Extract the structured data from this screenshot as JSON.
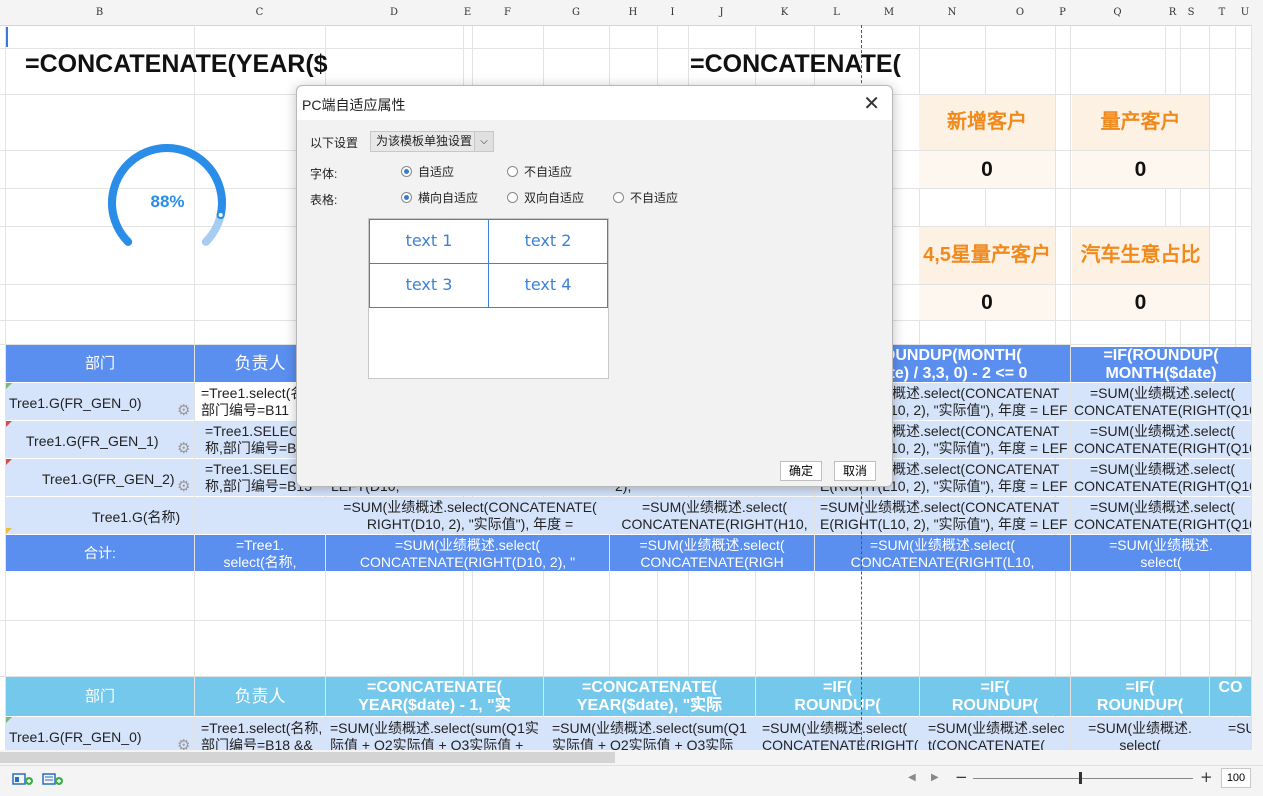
{
  "columns": [
    "B",
    "C",
    "D",
    "E",
    "F",
    "G",
    "H",
    "I",
    "J",
    "K",
    "L",
    "M",
    "N",
    "O",
    "P",
    "Q",
    "R",
    "S",
    "T",
    "U"
  ],
  "formulas": {
    "left": "=CONCATENATE(YEAR($",
    "right": "=CONCATENATE("
  },
  "gauge": {
    "value_text": "88%",
    "fraction": 0.88,
    "color": "#2a8ee8"
  },
  "kpis": [
    {
      "title": "新增客户",
      "value": "0"
    },
    {
      "title": "量产客户",
      "value": "0"
    },
    {
      "title": "4,5星量产客户",
      "value": "0"
    },
    {
      "title": "汽车生意占比",
      "value": "0"
    }
  ],
  "table1": {
    "headers": [
      "部门",
      "负责人",
      "=ROUNDUP(MONTH(\n$date) / 3,3, 0) - 2 <= 0",
      "=IF(ROUNDUP(\nMONTH($date)"
    ],
    "rows": [
      [
        "Tree1.G(FR_GEN_0)",
        "=Tree1.select(名\n部门编号=B11",
        "=SUM(业绩概述.select(CONCATENAT\nE(RIGHT(L10, 2), \"实际值\"), 年度 = LEF",
        "=SUM(业绩概述.select(\nCONCATENATE(RIGHT(Q10"
      ],
      [
        "Tree1.G(FR_GEN_1)",
        "=Tree1.SELECT\n称,部门编号=B",
        "=SUM(业绩概述.select(CONCATENAT\nE(RIGHT(L10, 2), \"实际值\"), 年度 = LEF",
        "=SUM(业绩概述.select(\nCONCATENATE(RIGHT(Q10"
      ],
      [
        "Tree1.G(FR_GEN_2)",
        "=Tree1.SELECT\n称,部门编号=B13",
        "=SUM(业绩概述.select(CONCATENAT\nE(RIGHT(L10, 2), \"实际值\"), 年度 = LEF",
        "=SUM(业绩概述.select(\nCONCATENATE(RIGHT(Q10"
      ],
      [
        "Tree1.G(名称)",
        "",
        "=SUM(业绩概述.select(CONCATENAT\nE(RIGHT(L10, 2), \"实际值\"), 年度 = LEF",
        "=SUM(业绩概述.select(\nCONCATENATE(RIGHT(Q10"
      ]
    ],
    "mid_rows": [
      [
        "RIGHT(D10, 2), \"实际值\"), 年度 = LEFT(D10,",
        "CONCATENATE(RIGHT(H10, 2),"
      ],
      [
        "=SUM(业绩概述.select(CONCATENATE(\nRIGHT(D10, 2), \"实际值\"), 年度 = LEFT(D10,",
        "=SUM(业绩概述.select(\nCONCATENATE(RIGHT(H10, 2),"
      ]
    ],
    "total": [
      "合计:",
      "=Tree1.\nselect(名称,",
      "=SUM(业绩概述.select(\nCONCATENATE(RIGHT(D10, 2), \"",
      "=SUM(业绩概述.select(\nCONCATENATE(RIGH",
      "=SUM(业绩概述.select(\nCONCATENATE(RIGHT(L10,",
      "=SUM(业绩概述.\nselect("
    ]
  },
  "table2": {
    "headers": [
      "部门",
      "负责人",
      "=CONCATENATE(\nYEAR($date) - 1, \"实",
      "=CONCATENATE(\nYEAR($date), \"实际",
      "=IF(\nROUNDUP(",
      "=IF(\nROUNDUP(",
      "=IF(\nROUNDUP(",
      "CO"
    ],
    "row": [
      "Tree1.G(FR_GEN_0)",
      "=Tree1.select(名称,\n部门编号=B18 &&",
      "=SUM(业绩概述.select(sum(Q1实\n际值 + Q2实际值 + Q3实际值 +",
      "=SUM(业绩概述.select(sum(Q1\n实际值 + Q2实际值 + Q3实际",
      "=SUM(业绩概述.select(\nCONCATENATE(RIGHT(",
      "=SUM(业绩概述.selec\nt(CONCATENATE(",
      "=SUM(业绩概述.\nselect(",
      "=SU"
    ]
  },
  "dialog": {
    "title": "PC端自适应属性",
    "setting_label": "以下设置",
    "setting_value": "为该模板单独设置",
    "font_label": "字体:",
    "font_options": [
      "自适应",
      "不自适应"
    ],
    "table_label": "表格:",
    "table_options": [
      "横向自适应",
      "双向自适应",
      "不自适应"
    ],
    "preview_cells": [
      "text 1",
      "text 2",
      "text 3",
      "text 4"
    ],
    "ok_label": "确定",
    "cancel_label": "取消"
  },
  "statusbar": {
    "zoom": "100",
    "zoom_minus": "−",
    "zoom_plus": "+",
    "zoom_fraction": 0.48
  }
}
